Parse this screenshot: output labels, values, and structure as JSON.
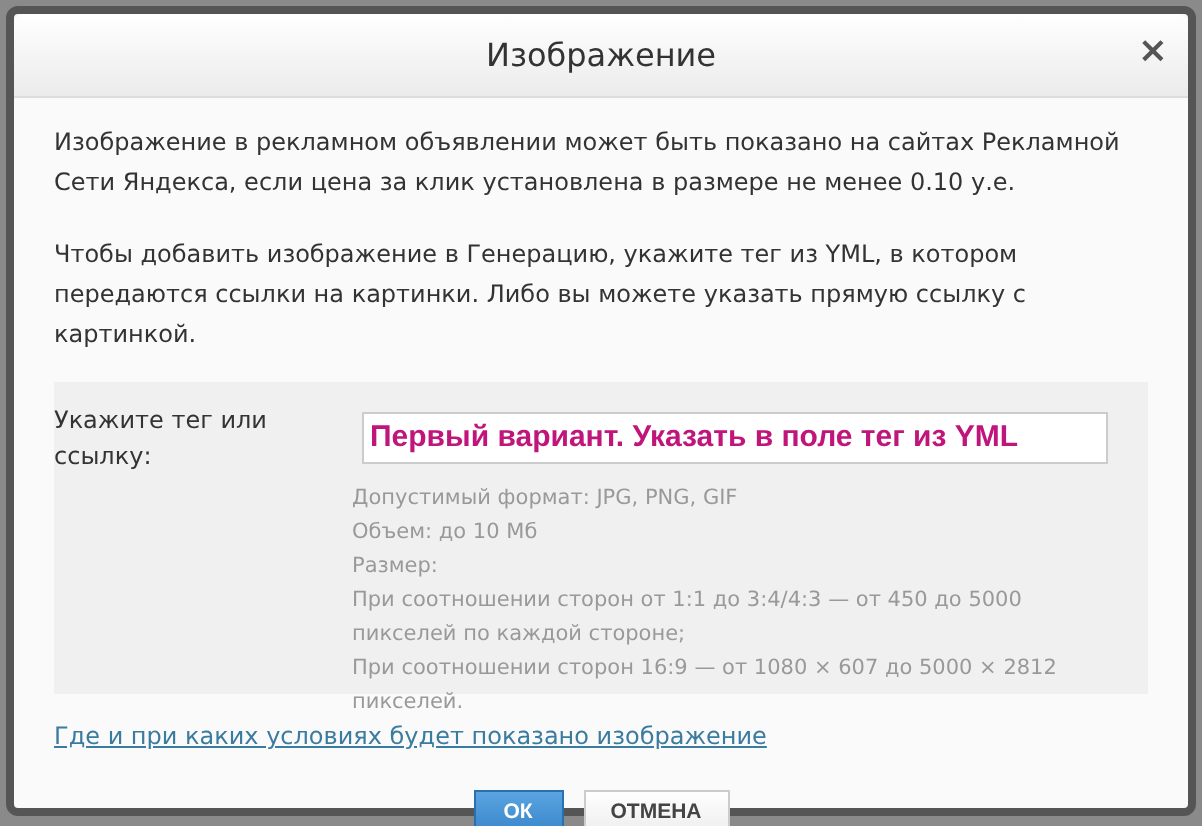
{
  "dialog": {
    "title": "Изображение",
    "close": "×",
    "paragraphs": [
      "Изображение в рекламном объявлении может быть показано на сайтах Рекламной Сети Яндекса, если цена за клик установлена в размере не менее 0.10 у.е.",
      "Чтобы добавить изображение в Генерацию, укажите тег из YML, в котором передаются ссылки на картинки. Либо вы можете указать прямую ссылку с картинкой."
    ],
    "field": {
      "label": "Укажите тег или ссылку:",
      "value": "Первый вариант. Указать в поле тег из YML"
    },
    "hints": [
      "Допустимый формат: JPG, PNG, GIF",
      "Объем: до 10 Мб",
      "Размер:",
      "При соотношении сторон от 1:1 до 3:4/4:3 — от 450 до 5000 пикселей по каждой стороне;",
      "При соотношении сторон 16:9 — от 1080 × 607 до 5000 × 2812 пикселей."
    ],
    "link": "Где и при каких условиях будет показано изображение",
    "buttons": [
      {
        "label": "ОК",
        "kind": "primary"
      },
      {
        "label": "ОТМЕНА",
        "kind": "secondary"
      }
    ]
  }
}
